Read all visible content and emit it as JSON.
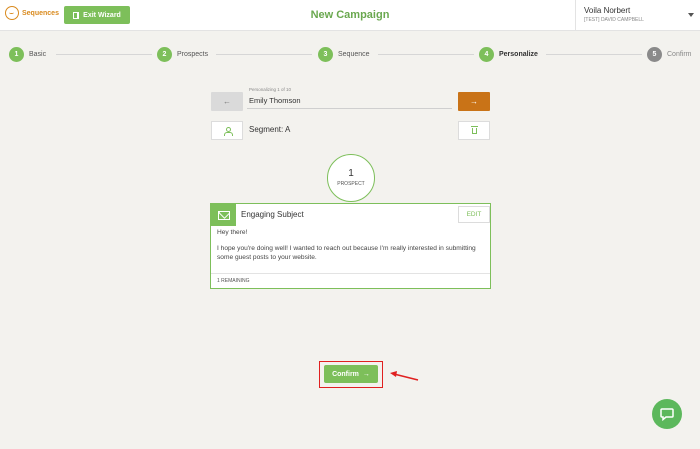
{
  "header": {
    "brand": "Sequences",
    "exit_label": "Exit Wizard",
    "title": "New Campaign",
    "user_name": "Voila Norbert",
    "user_sub": "[TEST] DAVID CAMPBELL"
  },
  "steps": [
    {
      "number": "1",
      "label": "Basic",
      "state": "done"
    },
    {
      "number": "2",
      "label": "Prospects",
      "state": "done"
    },
    {
      "number": "3",
      "label": "Sequence",
      "state": "done"
    },
    {
      "number": "4",
      "label": "Personalize",
      "state": "active"
    },
    {
      "number": "5",
      "label": "Confirm",
      "state": "pending"
    }
  ],
  "personalize": {
    "counter": "Personalizing 1 of 10",
    "prospect_name": "Emily Thomson",
    "prev_arrow": "←",
    "next_arrow": "→",
    "segment": "Segment: A"
  },
  "prospect_badge": {
    "count": "1",
    "label": "PROSPECT"
  },
  "email": {
    "subject": "Engaging Subject",
    "edit_label": "EDIT",
    "greeting": "Hey there!",
    "body": "I hope you're doing well! I wanted to reach out because I'm really interested in submitting some guest posts to your website.",
    "remaining": "1 REMAINING"
  },
  "confirm": {
    "label": "Confirm",
    "arrow": "→"
  },
  "colors": {
    "accent": "#7dbf5a",
    "next": "#c97317",
    "highlight": "#e02020",
    "brand": "#d98a1e"
  }
}
